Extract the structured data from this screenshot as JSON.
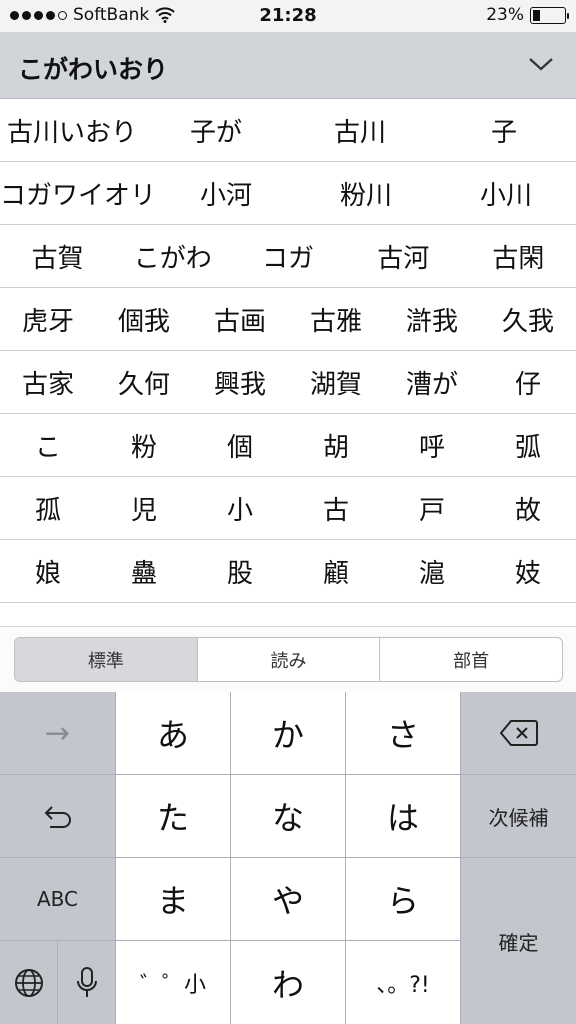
{
  "status_bar": {
    "carrier": "SoftBank",
    "time": "21:28",
    "battery": "23%",
    "battery_level": 0.23,
    "signal_bars": 4
  },
  "input": {
    "reading": "こがわいおり"
  },
  "candidates": [
    [
      "古川いおり",
      "子が",
      "古川",
      "子"
    ],
    [
      "コガワイオリ",
      "小河",
      "粉川",
      "小川"
    ],
    [
      "古賀",
      "こがわ",
      "コガ",
      "古河",
      "古閑"
    ],
    [
      "虎牙",
      "個我",
      "古画",
      "古雅",
      "滸我",
      "久我"
    ],
    [
      "古家",
      "久何",
      "興我",
      "湖賀",
      "漕が",
      "仔"
    ],
    [
      "こ",
      "粉",
      "個",
      "胡",
      "呼",
      "弧"
    ],
    [
      "孤",
      "児",
      "小",
      "古",
      "戸",
      "故"
    ],
    [
      "娘",
      "蠱",
      "股",
      "顧",
      "滬",
      "妓"
    ],
    [
      "",
      "",
      "",
      "",
      "",
      ""
    ]
  ],
  "segments": [
    {
      "label": "標準",
      "active": true
    },
    {
      "label": "読み",
      "active": false
    },
    {
      "label": "部首",
      "active": false
    }
  ],
  "keyboard": {
    "left": {
      "arrow": "→",
      "undo": "↶",
      "abc": "ABC",
      "globe": "globe-icon",
      "mic": "microphone-icon"
    },
    "kana": [
      "あ",
      "か",
      "さ",
      "た",
      "な",
      "は",
      "ま",
      "や",
      "ら",
      "゛゜小",
      "わ",
      "、。?!"
    ],
    "right": {
      "delete": "delete-icon",
      "next": "次候補",
      "confirm": "確定"
    }
  }
}
